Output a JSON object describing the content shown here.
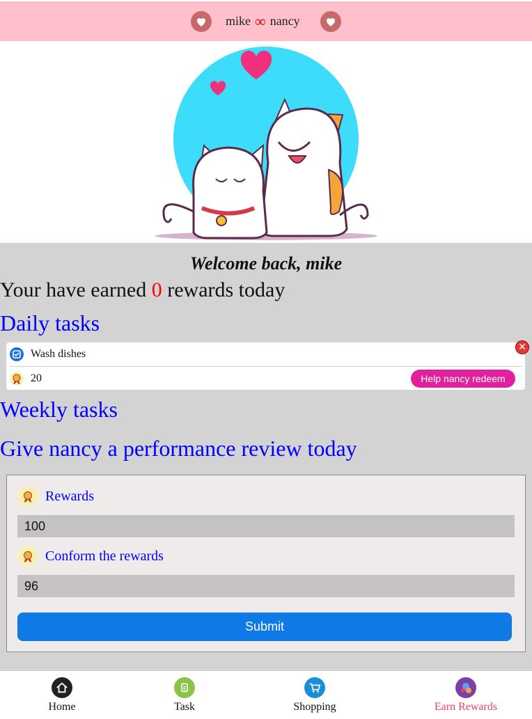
{
  "header": {
    "user": "mike",
    "partner": "nancy",
    "separator": "∞"
  },
  "hero": {
    "image": "two-cartoon-cats-with-hearts"
  },
  "welcome": "Welcome back, mike",
  "earned": {
    "prefix": "Your have earned",
    "count": "0",
    "suffix": "rewards today"
  },
  "sections": {
    "daily": "Daily tasks",
    "weekly": "Weekly tasks",
    "review": "Give nancy a performance review today"
  },
  "daily_task": {
    "name": "Wash dishes",
    "reward": "20",
    "redeem_label": "Help nancy redeem"
  },
  "form": {
    "rewards_label": "Rewards",
    "rewards_value": "100",
    "confirm_label": "Conform the rewards",
    "confirm_value": "96",
    "submit_label": "Submit"
  },
  "nav": {
    "home": "Home",
    "task": "Task",
    "shopping": "Shopping",
    "earn": "Earn Rewards"
  },
  "colors": {
    "topbar": "#ffc0cb",
    "link": "#0000ff",
    "accent": "#e0209c",
    "submit": "#0f7ae5",
    "active_nav": "#e0407a"
  }
}
